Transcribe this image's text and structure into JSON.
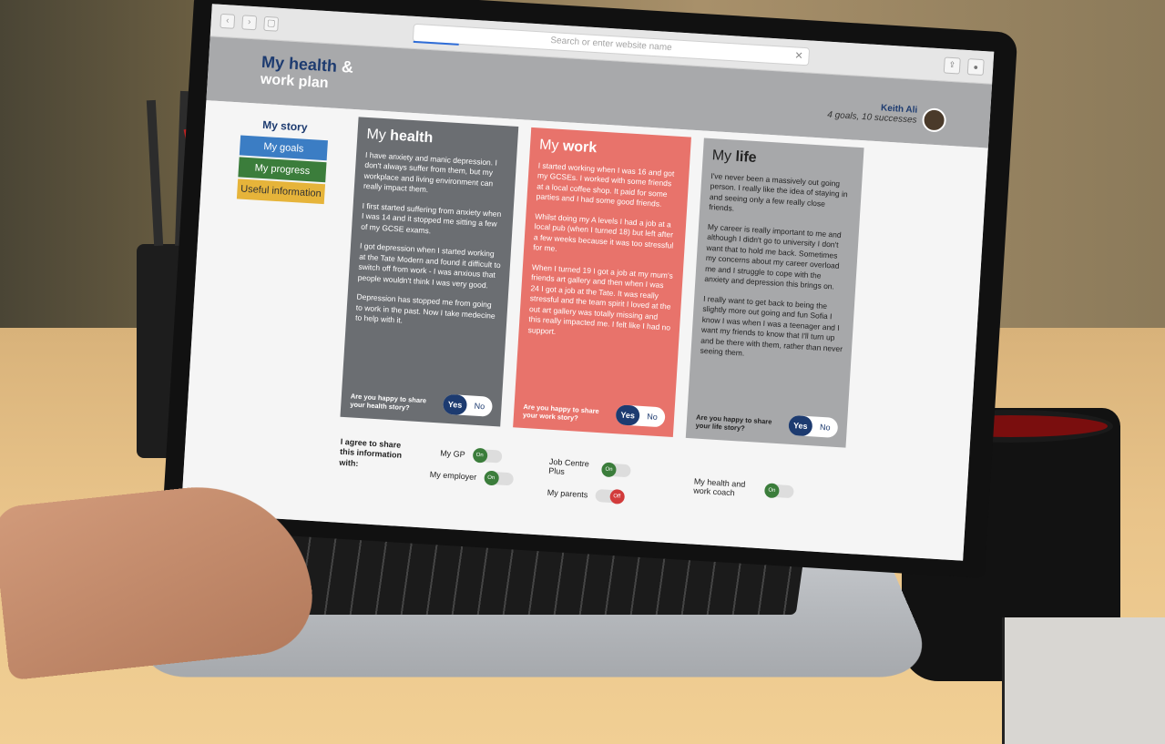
{
  "browser": {
    "address_placeholder": "Search or enter website name",
    "clear_glyph": "✕",
    "back_glyph": "‹",
    "forward_glyph": "›",
    "sidebar_glyph": "▢",
    "share_glyph": "⇪",
    "download_glyph": "●"
  },
  "header": {
    "logo_line1_a": "My health",
    "logo_line1_b": " &",
    "logo_line2": "work plan",
    "user_name": "Keith Ali",
    "user_meta": "4 goals, 10 successes"
  },
  "sidebar": {
    "title": "My story",
    "items": [
      {
        "label": "My goals"
      },
      {
        "label": "My progress"
      },
      {
        "label": "Useful information"
      }
    ]
  },
  "cards": {
    "health": {
      "title_a": "My ",
      "title_b": "health",
      "paragraphs": [
        "I have anxiety and manic depression. I don't always suffer from them, but my workplace and living environment can really impact them.",
        "I first started suffering from anxiety when I was 14 and it stopped me sitting a few of my GCSE exams.",
        "I got depression when I started working at the Tate Modern and found it difficult to switch off from work - I was anxious that people wouldn't think I was very good.",
        "Depression has stopped me from going to work in the past. Now I take medecine to help with it."
      ],
      "question": "Are you happy to share your health story?",
      "yes": "Yes",
      "no": "No"
    },
    "work": {
      "title_a": "My ",
      "title_b": "work",
      "paragraphs": [
        "I started working when I was 16 and got my GCSEs. I worked with some friends at a local coffee shop. It paid for some parties and I had some good friends.",
        "Whilst doing my A levels I had a job at a local pub (when I turned 18) but left after a few weeks because it was too stressful for me.",
        "When I turned 19 I got a job at my mum's friends art gallery and then when I was 24 I got a job at the Tate. It was really stressful and the team spirit I loved at the out art gallery was totally missing and this really impacted me. I felt like I had no support."
      ],
      "question": "Are you happy to share your work story?",
      "yes": "Yes",
      "no": "No"
    },
    "life": {
      "title_a": "My ",
      "title_b": "life",
      "paragraphs": [
        "I've never been a massively out going person. I really like the idea of staying in and seeing only a few really close friends.",
        "My career is really important to me and although I didn't go to university I don't want that to hold me back. Sometimes my concerns about my career overload me and I struggle to cope with the anxiety and depression this brings on.",
        "I really want to get back to being the slightly more out going and fun Sofia I know I was when I was a teenager and I want my friends to know that I'll turn up and be there with them, rather than never seeing them."
      ],
      "question": "Are you happy to share your life story?",
      "yes": "Yes",
      "no": "No"
    }
  },
  "agree": {
    "label": "I agree to share this information with:",
    "toggles": [
      {
        "label": "My GP",
        "state": "On"
      },
      {
        "label": "My employer",
        "state": "On"
      },
      {
        "label": "Job Centre Plus",
        "state": "On"
      },
      {
        "label": "My parents",
        "state": "Off"
      },
      {
        "label": "My health and work coach",
        "state": "On"
      }
    ]
  },
  "colors": {
    "brand_navy": "#1d3b70",
    "health_card": "#6b6e72",
    "work_card": "#e8736b",
    "life_card": "#a7a8aa",
    "goals": "#3b7dc4",
    "progress": "#3b7d3b",
    "info": "#e6b43a",
    "toggle_on": "#3b7d3b",
    "toggle_off": "#d23b3b"
  }
}
